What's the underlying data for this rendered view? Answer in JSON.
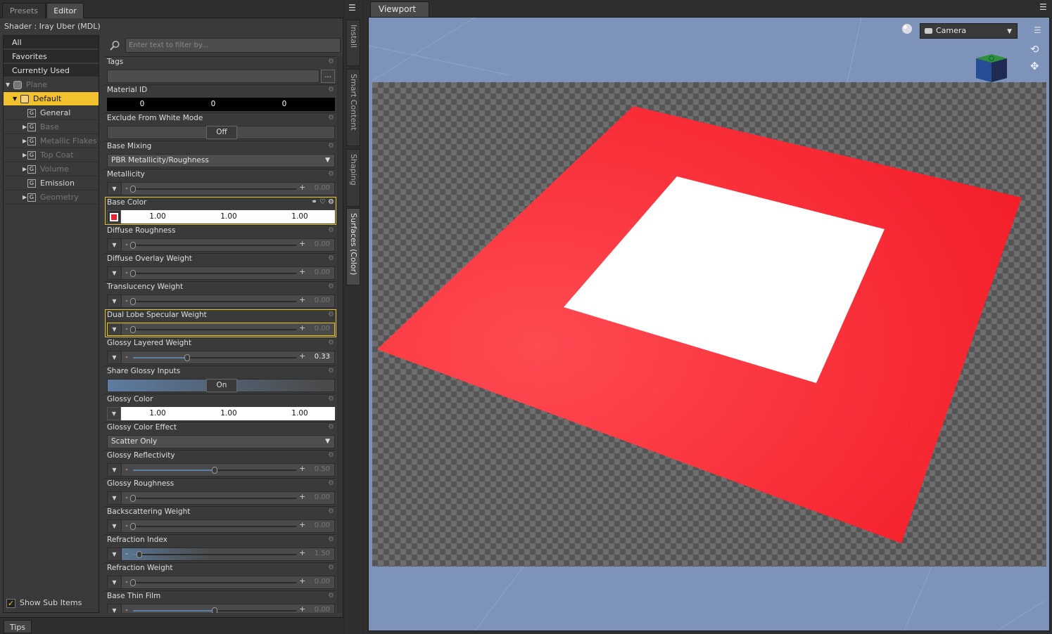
{
  "tabs": {
    "presets": "Presets",
    "editor": "Editor"
  },
  "shader_label": "Shader :  Iray Uber (MDL)",
  "nav": {
    "filters": [
      "All",
      "Favorites",
      "Currently Used"
    ],
    "tree": [
      {
        "label": "Plane",
        "state": "dim",
        "kind": "object",
        "expander": "open"
      },
      {
        "label": "Default",
        "state": "selected",
        "kind": "material",
        "expander": "open"
      },
      {
        "label": "General",
        "state": "normal",
        "kind": "group",
        "expander": "none"
      },
      {
        "label": "Base",
        "state": "dim",
        "kind": "group",
        "expander": "closed"
      },
      {
        "label": "Metallic Flakes",
        "state": "dim",
        "kind": "group",
        "expander": "closed"
      },
      {
        "label": "Top Coat",
        "state": "dim",
        "kind": "group",
        "expander": "closed"
      },
      {
        "label": "Volume",
        "state": "dim",
        "kind": "group",
        "expander": "closed"
      },
      {
        "label": "Emission",
        "state": "normal",
        "kind": "group",
        "expander": "none"
      },
      {
        "label": "Geometry",
        "state": "dim",
        "kind": "group",
        "expander": "closed"
      }
    ],
    "show_sub_items": "Show Sub Items",
    "show_sub_items_checked": true
  },
  "filter": {
    "placeholder": "Enter text to filter by..."
  },
  "properties": [
    {
      "label": "Tags",
      "type": "tags",
      "button": "..."
    },
    {
      "label": "Material ID",
      "type": "triple",
      "values": [
        "0",
        "0",
        "0"
      ],
      "style": "dark"
    },
    {
      "label": "Exclude From White Mode",
      "type": "toggle",
      "value": "Off",
      "on": false
    },
    {
      "label": "Base Mixing",
      "type": "dropdown",
      "value": "PBR Metallicity/Roughness"
    },
    {
      "label": "Metallicity",
      "type": "slider",
      "value": "0.00",
      "fraction": 0.0
    },
    {
      "label": "Base Color",
      "type": "color",
      "values": [
        "1.00",
        "1.00",
        "1.00"
      ],
      "highlight": true,
      "color": "#e8212e"
    },
    {
      "label": "Diffuse Roughness",
      "type": "slider",
      "value": "0.00",
      "fraction": 0.0
    },
    {
      "label": "Diffuse Overlay Weight",
      "type": "slider",
      "value": "0.00",
      "fraction": 0.0
    },
    {
      "label": "Translucency Weight",
      "type": "slider",
      "value": "0.00",
      "fraction": 0.0
    },
    {
      "label": "Dual Lobe Specular Weight",
      "type": "slider",
      "value": "0.00",
      "fraction": 0.0,
      "highlight": true
    },
    {
      "label": "Glossy Layered Weight",
      "type": "slider",
      "value": "0.33",
      "fraction": 0.33,
      "active": true
    },
    {
      "label": "Share Glossy Inputs",
      "type": "toggle",
      "value": "On",
      "on": true
    },
    {
      "label": "Glossy Color",
      "type": "triple",
      "values": [
        "1.00",
        "1.00",
        "1.00"
      ],
      "style": "white"
    },
    {
      "label": "Glossy Color Effect",
      "type": "dropdown",
      "value": "Scatter Only"
    },
    {
      "label": "Glossy Reflectivity",
      "type": "slider",
      "value": "0.50",
      "fraction": 0.5
    },
    {
      "label": "Glossy Roughness",
      "type": "slider",
      "value": "0.00",
      "fraction": 0.0
    },
    {
      "label": "Backscattering Weight",
      "type": "slider",
      "value": "0.00",
      "fraction": 0.0
    },
    {
      "label": "Refraction Index",
      "type": "slider",
      "value": "1.50",
      "fraction": 0.04
    },
    {
      "label": "Refraction Weight",
      "type": "slider",
      "value": "0.00",
      "fraction": 0.0
    },
    {
      "label": "Base Thin Film",
      "type": "slider",
      "value": "0.00",
      "fraction": 0.5
    }
  ],
  "side_tabs": [
    "Install",
    "Smart Content",
    "Shaping",
    "Surfaces (Color)"
  ],
  "side_tab_active": "Surfaces (Color)",
  "bottom_tab": "Tips",
  "viewport": {
    "tab_label": "Viewport",
    "camera": "Camera",
    "background_color": "#7d93ba",
    "plane_color": "#f8212e",
    "inner_square_color": "#ffffff"
  },
  "icons": {
    "filter": "search-icon",
    "gear": "gear-icon",
    "hamburger": "menu-icon",
    "dropdown": "chevron-down-icon"
  }
}
